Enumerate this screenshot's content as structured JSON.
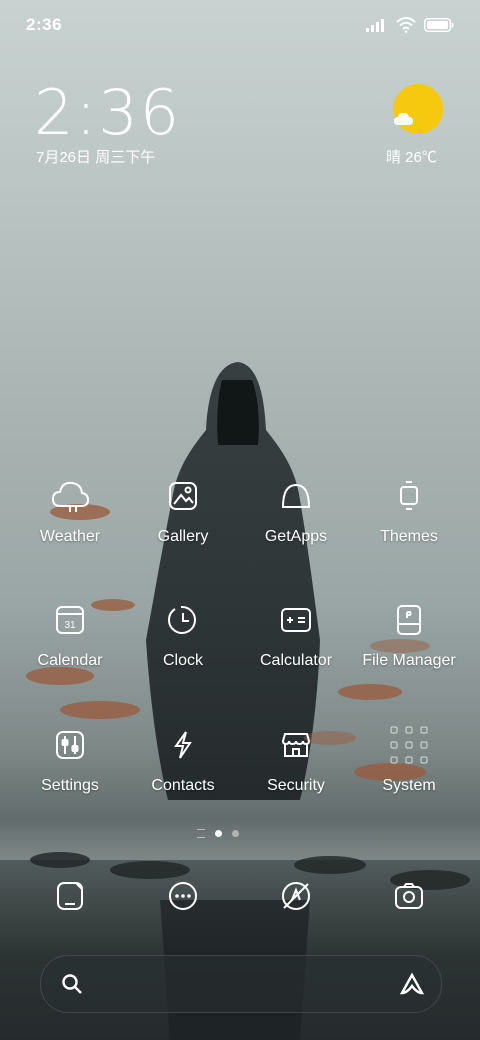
{
  "status_bar": {
    "time": "2:36",
    "icons": [
      "signal-icon",
      "wifi-icon",
      "battery-icon"
    ]
  },
  "clock_widget": {
    "time": "2:36",
    "date": "7月26日 周三下午"
  },
  "weather_widget": {
    "text": "晴 26℃",
    "icon": "sun-cloud-icon"
  },
  "apps": [
    {
      "label": "Weather",
      "icon": "weather-cloud-icon"
    },
    {
      "label": "Gallery",
      "icon": "gallery-icon"
    },
    {
      "label": "GetApps",
      "icon": "getapps-icon"
    },
    {
      "label": "Themes",
      "icon": "themes-icon"
    },
    {
      "label": "Calendar",
      "icon": "calendar-icon",
      "day": "31"
    },
    {
      "label": "Clock",
      "icon": "clock-icon"
    },
    {
      "label": "Calculator",
      "icon": "calculator-icon"
    },
    {
      "label": "File Manager",
      "icon": "file-manager-icon"
    },
    {
      "label": "Settings",
      "icon": "settings-icon"
    },
    {
      "label": "Contacts",
      "icon": "contacts-icon"
    },
    {
      "label": "Security",
      "icon": "security-icon"
    },
    {
      "label": "System",
      "icon": "system-folder-icon"
    }
  ],
  "pager": {
    "pages": 2,
    "current": 1
  },
  "dock": [
    "phone-icon",
    "messages-icon",
    "browser-icon",
    "camera-icon"
  ],
  "search_bar": {
    "icons": [
      "search-icon",
      "assistant-icon"
    ]
  },
  "colors": {
    "sun": "#f6c90e",
    "background_top": "#c9d2d1",
    "background_bottom": "#252b2c"
  }
}
